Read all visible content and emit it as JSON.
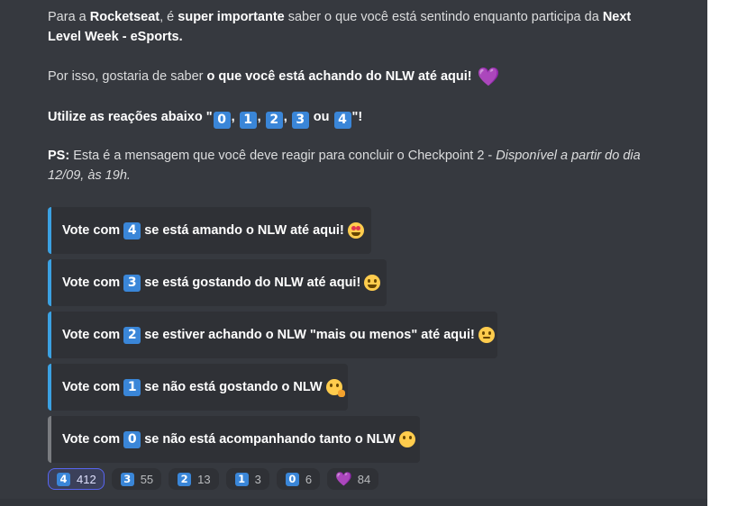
{
  "message": {
    "p1": {
      "a": "Para a ",
      "b": "Rocketseat",
      "c": ", é ",
      "d": "super importante",
      "e": " saber o que você está sentindo enquanto participa da ",
      "f": "Next",
      "g": "Level Week - eSports."
    },
    "p2": {
      "a": "Por isso, gostaria de saber ",
      "b": "o que você está achando do NLW até aqui!",
      "heart": "💜"
    },
    "p3": {
      "a": "Utilize as reações abaixo \"",
      "k0": "0",
      "sep1": ",",
      "k1": "1",
      "sep2": ",",
      "k2": "2",
      "sep3": ",",
      "k3": "3",
      "or": "ou",
      "k4": "4",
      "end": "\"!"
    },
    "p4": {
      "a": "PS:",
      "b": " Esta é a mensagem que você deve reagir para concluir o Checkpoint 2 - ",
      "c": "Disponível a partir do dia",
      "d": "12/09, às 19h."
    }
  },
  "embeds": [
    {
      "prefix": "Vote com",
      "key": "4",
      "text": "se está amando o NLW até aqui!",
      "emoji": "heart-eyes-emoji",
      "accent": "#3ba1e2"
    },
    {
      "prefix": "Vote com",
      "key": "3",
      "text": "se está gostando do NLW até aqui!",
      "emoji": "grinning-emoji",
      "accent": "#3ba1e2"
    },
    {
      "prefix": "Vote com",
      "key": "2",
      "text": "se estiver achando o NLW \"mais ou menos\" até aqui!",
      "emoji": "neutral-face-emoji",
      "accent": "#3ba1e2"
    },
    {
      "prefix": "Vote com",
      "key": "1",
      "text": "se não está gostando o NLW",
      "emoji": "yawning-face-emoji",
      "accent": "#3ba1e2"
    },
    {
      "prefix": "Vote com",
      "key": "0",
      "text": "se não está acompanhando tanto o NLW",
      "emoji": "no-mouth-face-emoji",
      "accent": "#7a7c80"
    }
  ],
  "reactions": [
    {
      "key": "4",
      "count": "412",
      "active": true
    },
    {
      "key": "3",
      "count": "55"
    },
    {
      "key": "2",
      "count": "13"
    },
    {
      "key": "1",
      "count": "3"
    },
    {
      "key": "0",
      "count": "6"
    },
    {
      "emoji": "💜",
      "count": "84"
    }
  ],
  "colors": {
    "background": "#36393f",
    "embed_bg": "#2f3136",
    "keycap": "#3a86d8",
    "accent_blue": "#3ba1e2",
    "reaction_active": "#5865f2"
  }
}
